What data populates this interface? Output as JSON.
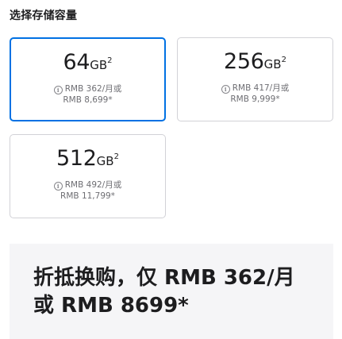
{
  "heading": "选择存储容量",
  "options": [
    {
      "capacity": "64",
      "unit": "GB",
      "footnote": "2",
      "monthly": "RMB 362/月或",
      "full_price": "RMB 8,699*",
      "selected": true
    },
    {
      "capacity": "256",
      "unit": "GB",
      "footnote": "2",
      "monthly": "RMB 417/月或",
      "full_price": "RMB 9,999*",
      "selected": false
    },
    {
      "capacity": "512",
      "unit": "GB",
      "footnote": "2",
      "monthly": "RMB 492/月或",
      "full_price": "RMB 11,799*",
      "selected": false
    }
  ],
  "info_icon": "info-circle-icon",
  "promo": {
    "line1": "折抵换购，仅 RMB 362/月",
    "line2": "或 RMB 8699*"
  },
  "colors": {
    "selected_border": "#0071e3",
    "border": "#d2d2d7",
    "promo_bg": "#f5f5f7"
  }
}
